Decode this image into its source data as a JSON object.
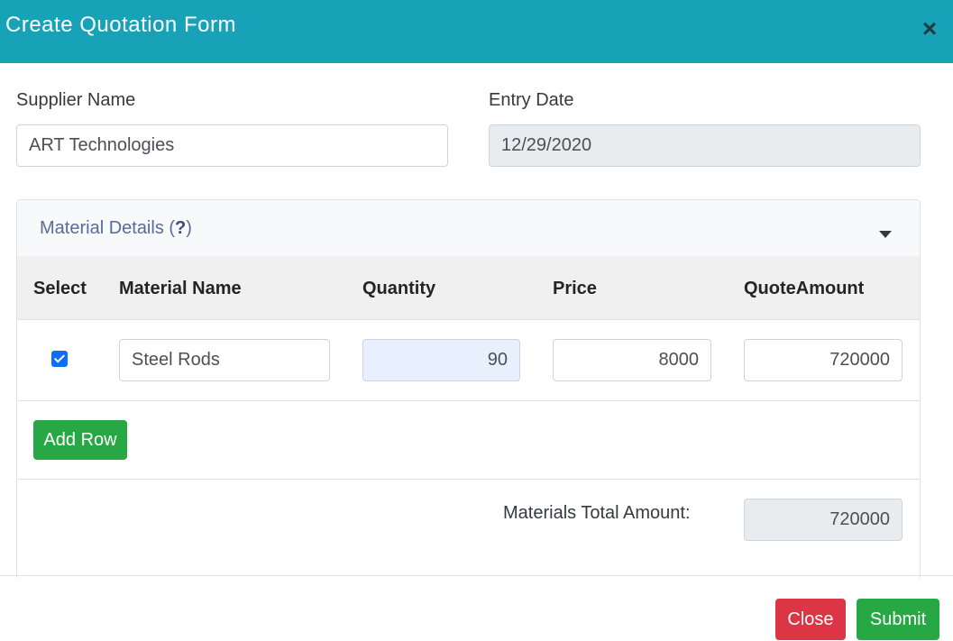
{
  "header": {
    "title": "Create Quotation Form",
    "close_glyph": "×"
  },
  "form": {
    "supplier_label": "Supplier Name",
    "supplier_value": "ART Technologies",
    "date_label": "Entry Date",
    "date_value": "12/29/2020"
  },
  "materials": {
    "title": "Material Details (",
    "help": "?",
    "title_end": ")",
    "columns": [
      "Select",
      "Material Name",
      "Quantity",
      "Price",
      "QuoteAmount"
    ],
    "rows": [
      {
        "selected": true,
        "material_name": "Steel Rods",
        "quantity": "90",
        "price": "8000",
        "quote_amount": "720000"
      }
    ],
    "add_row_label": "Add Row",
    "total_label": "Materials Total Amount:",
    "total_value": "720000"
  },
  "footer": {
    "close_label": "Close",
    "submit_label": "Submit"
  },
  "colors": {
    "header_bg": "#17a2b8",
    "success": "#28a745",
    "danger": "#dc3545",
    "checkbox": "#0d6efd"
  },
  "icons": {
    "close": "close-icon",
    "collapse": "caret-down-icon",
    "check": "checkmark-icon"
  }
}
